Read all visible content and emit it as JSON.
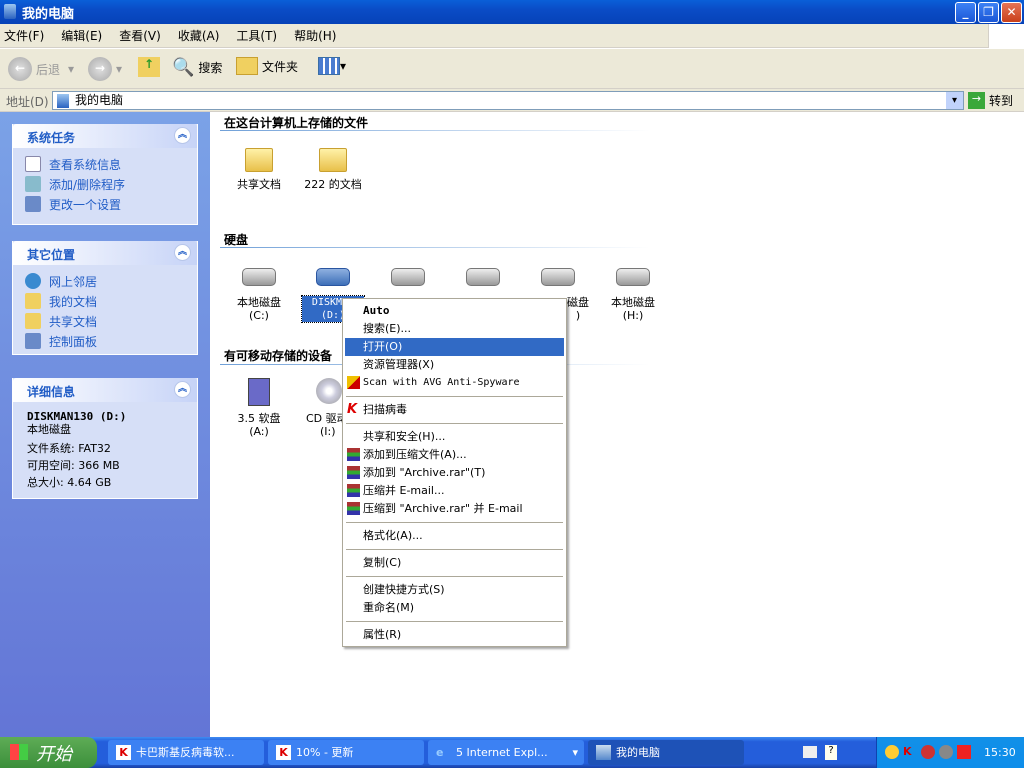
{
  "window": {
    "title": "我的电脑"
  },
  "menu": [
    "文件(F)",
    "编辑(E)",
    "查看(V)",
    "收藏(A)",
    "工具(T)",
    "帮助(H)"
  ],
  "toolbar": {
    "back": "后退",
    "search": "搜索",
    "folders": "文件夹"
  },
  "address": {
    "label": "地址(D)",
    "value": "我的电脑",
    "go": "转到"
  },
  "left": {
    "system_tasks": {
      "title": "系统任务",
      "items": [
        "查看系统信息",
        "添加/删除程序",
        "更改一个设置"
      ]
    },
    "other_places": {
      "title": "其它位置",
      "items": [
        "网上邻居",
        "我的文档",
        "共享文档",
        "控制面板"
      ]
    },
    "details": {
      "title": "详细信息",
      "name": "DISKMAN130 (D:)",
      "type": "本地磁盘",
      "fs": "文件系统: FAT32",
      "free": "可用空间: 366 MB",
      "total": "总大小: 4.64 GB"
    }
  },
  "main": {
    "files_title": "在这台计算机上存储的文件",
    "files": [
      "共享文档",
      "222 的文档"
    ],
    "hdd_title": "硬盘",
    "drives": [
      {
        "name": "本地磁盘",
        "letter": "(C:)"
      },
      {
        "name": "DISKMAN",
        "letter": "(D:)"
      },
      {
        "name": "",
        "letter": ""
      },
      {
        "name": "",
        "letter": ""
      },
      {
        "name": "磁盘",
        "letter": ")"
      },
      {
        "name": "本地磁盘",
        "letter": "(H:)"
      }
    ],
    "removable_title": "有可移动存储的设备",
    "removable": [
      {
        "name": "3.5 软盘",
        "letter": "(A:)"
      },
      {
        "name": "CD 驱动",
        "letter": "(I:)"
      }
    ]
  },
  "context_menu": {
    "items": [
      "Auto",
      "搜索(E)...",
      "打开(O)",
      "资源管理器(X)",
      "Scan with AVG Anti-Spyware",
      "扫描病毒",
      "共享和安全(H)...",
      "添加到压缩文件(A)...",
      "添加到 \"Archive.rar\"(T)",
      "压缩并 E-mail...",
      "压缩到 \"Archive.rar\" 并 E-mail",
      "格式化(A)...",
      "复制(C)",
      "创建快捷方式(S)",
      "重命名(M)",
      "属性(R)"
    ],
    "highlighted": "打开(O)"
  },
  "taskbar": {
    "start": "开始",
    "tasks": [
      "卡巴斯基反病毒软...",
      "10% - 更新",
      "5 Internet Expl...",
      "我的电脑"
    ],
    "clock": "15:30"
  }
}
